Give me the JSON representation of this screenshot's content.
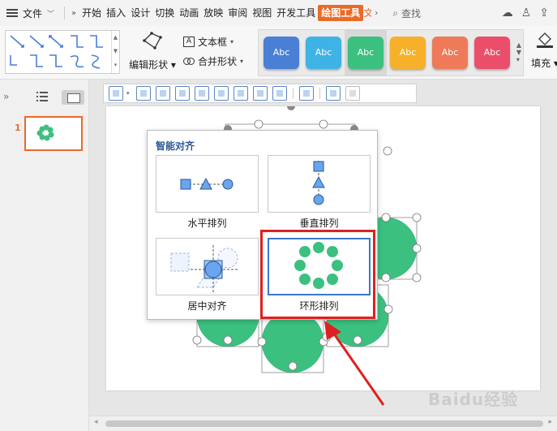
{
  "menubar": {
    "file_label": "文件",
    "tabs": [
      "开始",
      "插入",
      "设计",
      "切换",
      "动画",
      "放映",
      "审阅",
      "视图",
      "开发工具",
      "绘图工具",
      "文"
    ],
    "active_tab": "绘图工具",
    "search_label": "查找"
  },
  "ribbon": {
    "edit_shape_label": "编辑形状",
    "text_box_label": "文本框",
    "merge_shape_label": "合并形状",
    "fill_label": "填充",
    "styles": [
      {
        "label": "Abc",
        "color": "#4a7fd6"
      },
      {
        "label": "Abc",
        "color": "#3fb2e6"
      },
      {
        "label": "Abc",
        "color": "#3cc07f"
      },
      {
        "label": "Abc",
        "color": "#f6b02a"
      },
      {
        "label": "Abc",
        "color": "#ef7a5a"
      },
      {
        "label": "Abc",
        "color": "#eb4e6a"
      }
    ]
  },
  "slides_panel": {
    "slide_number": "1"
  },
  "smart_align": {
    "title": "智能对齐",
    "options": [
      {
        "label": "水平排列"
      },
      {
        "label": "垂直排列"
      },
      {
        "label": "居中对齐"
      },
      {
        "label": "环形排列"
      }
    ],
    "selected": "环形排列"
  },
  "colors": {
    "accent": "#e96b2a",
    "shape_green": "#3cc07f",
    "option_blue": "#6aa6ee",
    "highlight_red": "#e02020"
  },
  "watermark": "Baidu经验"
}
